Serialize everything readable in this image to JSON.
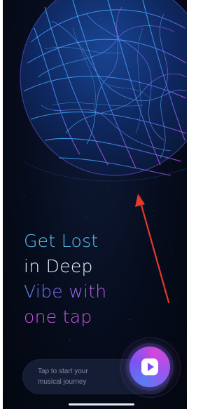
{
  "hero": {
    "image_name": "neural-sphere-art"
  },
  "headline": {
    "line1": "Get Lost",
    "line2": "in Deep",
    "line3": "Vibe with",
    "line4": "one tap"
  },
  "cta": {
    "text_line1": "Tap to start your",
    "text_line2": "musical journey",
    "play_icon": "play-icon"
  },
  "colors": {
    "background": "#060c1c",
    "accent_cyan": "#58c5f0",
    "accent_purple": "#cf56e6",
    "annotation_arrow": "#e53a2b"
  }
}
